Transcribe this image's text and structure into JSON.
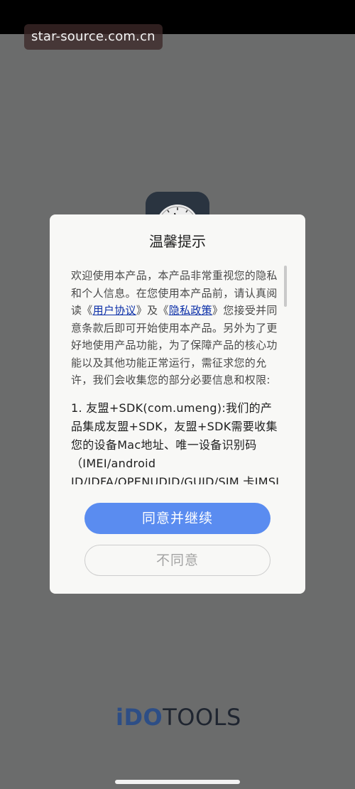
{
  "watermark": "star-source.com.cn",
  "dialog": {
    "title": "温馨提示",
    "intro_before_user_link": "欢迎使用本产品，本产品非常重视您的隐私和个人信息。在您使用本产品前，请认真阅读《",
    "user_agreement_link": "用户协议",
    "intro_between_links": "》及《",
    "privacy_policy_link": "隐私政策",
    "intro_after_links": "》您接受并同意条款后即可开始使用本产品。另外为了更好地使用产品功能，为了保障产品的核心功能以及其他功能正常运行，需征求您的允许，我们会收集您的部分必要信息和权限:",
    "item_1": "1. 友盟+SDK(com.umeng):我们的产品集成友盟+SDK，友盟+SDK需要收集您的设备Mac地址、唯一设备识别码（IMEI/android ID/IDFA/OPENUDID/GUID/SIM 卡IMSI信息）",
    "agree_label": "同意并继续",
    "disagree_label": "不同意"
  },
  "brand": {
    "part_i": "i",
    "part_do": "DO",
    "part_tools": "TOOLS"
  },
  "colors": {
    "overlay_background": "#6b6c6c",
    "dialog_background": "#f8f8f6",
    "primary_button": "#5a8cf0",
    "link": "#0b2fa8",
    "brand_blue": "#2d4e86"
  },
  "icons": {
    "app_icon": "clock-icon"
  }
}
